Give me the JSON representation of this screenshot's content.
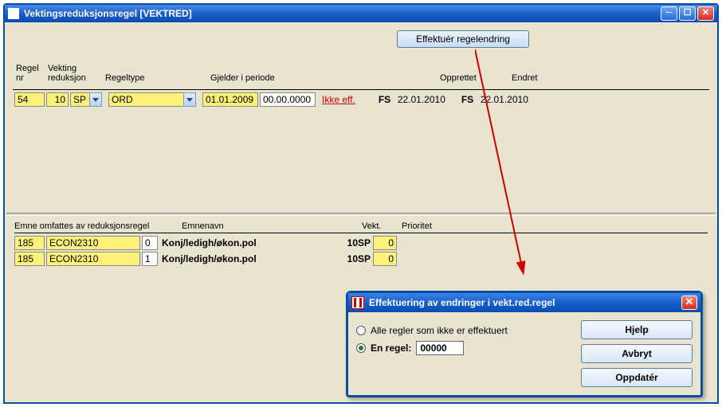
{
  "window": {
    "title": "Vektingsreduksjonsregel  [VEKTRED]"
  },
  "toolbar": {
    "effectuate": "Effektuér regelendring"
  },
  "headers": {
    "regel_nr_1": "Regel",
    "regel_nr_2": "nr",
    "vekting_1": "Vekting",
    "vekting_2": "reduksjon",
    "regeltype": "Regeltype",
    "gjelder": "Gjelder i periode",
    "opprettet": "Opprettet",
    "endret": "Endret"
  },
  "row": {
    "nr": "54",
    "reduksjon": "10",
    "enhet": "SP",
    "regeltype": "ORD",
    "fra": "01.01.2009",
    "til": "00.00.0000",
    "ikke_eff": "Ikke eff.",
    "opp_user": "FS",
    "opp_date": "22.01.2010",
    "end_user": "FS",
    "end_date": "22.01.2010"
  },
  "sub_headers": {
    "emne_omfattes": "Emne omfattes av reduksjonsregel",
    "emnenavn": "Emnenavn",
    "vekt": "Vekt.",
    "prioritet": "Prioritet"
  },
  "sub_rows": [
    {
      "a": "185",
      "b": "ECON2310",
      "c": "0",
      "navn": "Konj/ledigh/økon.pol",
      "vekt": "10SP",
      "pri": "0"
    },
    {
      "a": "185",
      "b": "ECON2310",
      "c": "1",
      "navn": "Konj/ledigh/økon.pol",
      "vekt": "10SP",
      "pri": "0"
    }
  ],
  "dialog": {
    "title": "Effektuering av endringer i vekt.red.regel",
    "opt_all": "Alle regler som ikke er effektuert",
    "opt_one": "En regel:",
    "one_value": "00000",
    "hjelp": "Hjelp",
    "avbryt": "Avbryt",
    "oppdater": "Oppdatér"
  }
}
